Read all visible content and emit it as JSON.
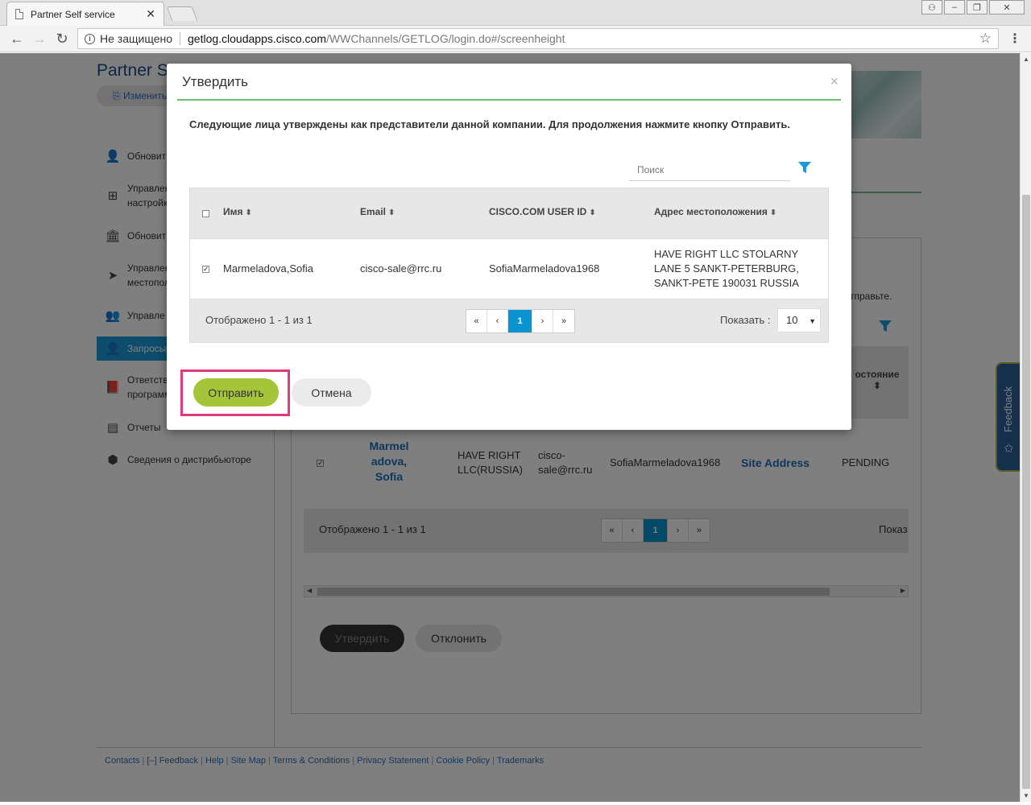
{
  "browser": {
    "tab_title": "Partner Self service",
    "security_label": "Не защищено",
    "url_domain": "getlog.cloudapps.cisco.com",
    "url_path": "/WWChannels/GETLOG/login.do#/screenheight"
  },
  "page": {
    "brand": "Partner S",
    "change_button": "Изменить",
    "sidebar": [
      {
        "label": "Обновить",
        "icon": "user-icon"
      },
      {
        "label": "Управлен настройк",
        "icon": "org-chart-icon"
      },
      {
        "label": "Обновит",
        "icon": "bank-icon"
      },
      {
        "label": "Управлен местопол",
        "icon": "location-arrow-icon"
      },
      {
        "label": "Управле",
        "icon": "users-icon"
      },
      {
        "label": "Запросы",
        "icon": "add-user-icon"
      },
      {
        "label": "Ответств программ",
        "icon": "book-icon"
      },
      {
        "label": "Отчеты",
        "icon": "file-icon"
      },
      {
        "label": "Сведения о дистрибьюторе",
        "icon": "cubes-icon"
      }
    ],
    "bg_partial_text": "тправьте.",
    "bg_status_header": "остояние",
    "bg_row": {
      "name": "Marmel adova, Sofia",
      "company": "HAVE RIGHT LLC(RUSSIA)",
      "email": "cisco- sale@rrc.ru",
      "user_id": "SofiaMarmeladova1968",
      "site": "Site Address",
      "status": "PENDING"
    },
    "bg_footer_text": "Отображено 1 - 1 из 1",
    "bg_show_label": "Показ",
    "bg_pager": [
      "«",
      "‹",
      "1",
      "›",
      "»"
    ],
    "approve_button": "Утвердить",
    "reject_button": "Отклонить",
    "feedback_tab": "Feedback",
    "footer": [
      "Contacts",
      "[–] Feedback",
      "Help",
      "Site Map",
      "Terms & Conditions",
      "Privacy Statement",
      "Cookie Policy",
      "Trademarks"
    ]
  },
  "modal": {
    "title": "Утвердить",
    "close": "×",
    "message": "Следующие лица утверждены как представители данной компании. Для продолжения нажмите кнопку Отправить.",
    "search_placeholder": "Поиск",
    "columns": [
      "Имя",
      "Email",
      "CISCO.COM USER ID",
      "Адрес местоположения"
    ],
    "rows": [
      {
        "checked": true,
        "name": "Marmeladova,Sofia",
        "email": "cisco-sale@rrc.ru",
        "user_id": "SofiaMarmeladova1968",
        "address": "HAVE RIGHT LLC STOLARNY LANE 5 SANKT-PETERBURG, SANKT-PETE 190031 RUSSIA"
      }
    ],
    "footer_text": "Отображено 1 - 1 из 1",
    "pager": [
      "«",
      "‹",
      "1",
      "›",
      "»"
    ],
    "show_label": "Показать :",
    "page_size": "10",
    "submit_button": "Отправить",
    "cancel_button": "Отмена"
  },
  "colors": {
    "accent_blue": "#0a93d1",
    "submit_green": "#a4c439",
    "highlight_pink": "#e0387a",
    "rule_green": "#6cc070"
  }
}
